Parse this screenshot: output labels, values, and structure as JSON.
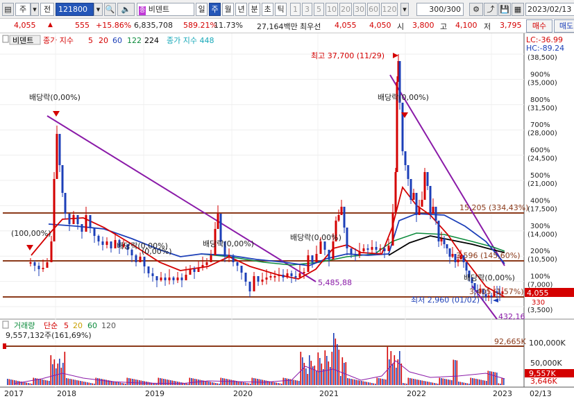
{
  "toolbar": {
    "tab1": "주",
    "tab2": "전",
    "code": "121800",
    "name": "비덴트",
    "periods": [
      "일",
      "주",
      "월",
      "년",
      "분",
      "초",
      "틱"
    ],
    "active_period": "주",
    "numbers": [
      "1",
      "3",
      "5",
      "10",
      "20",
      "30",
      "60",
      "120"
    ],
    "count": "300",
    "count_total": "/300",
    "date": "2023/02/13"
  },
  "quote": {
    "price": "4,055",
    "change": "555",
    "change_pct": "+15.86%",
    "volume": "6,835,708",
    "vol_ratio": "589.21%",
    "turnover": "11.73%",
    "amount": "27,164백만",
    "prio_label": "최우선",
    "prio1": "4,055",
    "prio2": "4,050",
    "open_label": "시",
    "open": "3,800",
    "high_label": "고",
    "high": "4,100",
    "low_label": "저",
    "low": "3,795",
    "buy": "매수",
    "sell": "매도"
  },
  "legend": {
    "name": "비덴트",
    "ma_label": "종가 지수",
    "ma": [
      "5",
      "20",
      "60",
      "122",
      "224"
    ],
    "ma2_label": "종가 지수 448",
    "lc": "LC:-36.99",
    "hc": "HC:-89.24"
  },
  "price_axis": {
    "labels": [
      {
        "pct": "",
        "val": "(38,500)"
      },
      {
        "pct": "900%",
        "val": "(35,000)"
      },
      {
        "pct": "800%",
        "val": "(31,500)"
      },
      {
        "pct": "700%",
        "val": "(28,000)"
      },
      {
        "pct": "600%",
        "val": "(24,500)"
      },
      {
        "pct": "500%",
        "val": "(21,000)"
      },
      {
        "pct": "400%",
        "val": "(17,500)"
      },
      {
        "pct": "300%",
        "val": "(14,000)"
      },
      {
        "pct": "200%",
        "val": "(10,500)"
      },
      {
        "pct": "100%",
        "val": "(7,000)"
      },
      {
        "pct": "",
        "val": "(3,500)"
      }
    ],
    "current": "4,055",
    "current_sub": "330"
  },
  "annotations": {
    "high": "최고 37,700 (11/29)",
    "low": "최저 2,960 (01/02)",
    "div1": "배당락(0,00%)",
    "div2": "(100,00%)",
    "div3": "배당락(0,00%)",
    "div4": "배당락(0,00%)",
    "div5": "배당락(0,00%)",
    "div6": "배당락(0,00%)",
    "div7": "배당락(0,00%)",
    "div8": "(0,00%)",
    "level1": "15,205 (334,43%)",
    "level2": "5,485,88",
    "level3": "3,596 (145,60%)",
    "level4": "3,405 (1,57%)",
    "level5": "432,16"
  },
  "volume": {
    "label": "거래량",
    "ma_label": "단순",
    "ma": [
      "5",
      "20",
      "60",
      "120"
    ],
    "last": "9,557,132주(161,69%)",
    "level": "92,665K",
    "axis": [
      "100,000K",
      "50,000K"
    ],
    "cur": "9,557K",
    "cur2": "3,646K"
  },
  "time_axis": [
    "2017",
    "2018",
    "2019",
    "2020",
    "2021",
    "2022",
    "2023",
    "02/13"
  ]
}
